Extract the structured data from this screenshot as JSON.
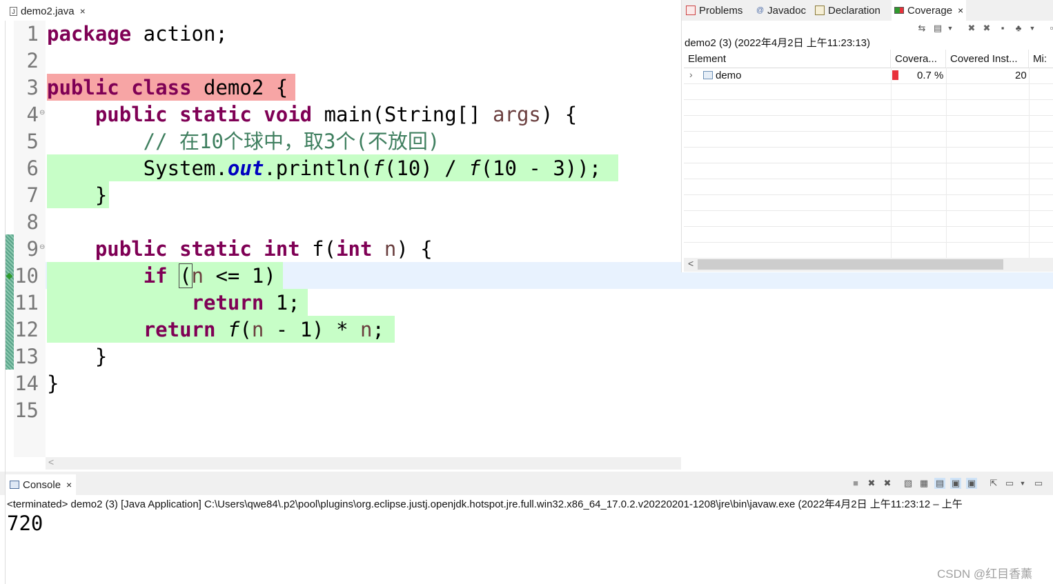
{
  "editor": {
    "tab_label": "demo2.java",
    "tab_close": "×",
    "file_icon": "J",
    "lines": [
      {
        "n": "1"
      },
      {
        "n": "2"
      },
      {
        "n": "3"
      },
      {
        "n": "4"
      },
      {
        "n": "5"
      },
      {
        "n": "6"
      },
      {
        "n": "7"
      },
      {
        "n": "8"
      },
      {
        "n": "9"
      },
      {
        "n": "10"
      },
      {
        "n": "11"
      },
      {
        "n": "12"
      },
      {
        "n": "13"
      },
      {
        "n": "14"
      },
      {
        "n": "15"
      }
    ],
    "code": {
      "l1_kw": "package",
      "l1_rest": " action;",
      "l3_kw1": "public",
      "l3_kw2": " class",
      "l3_rest": " demo2 {",
      "l4_indent": "    ",
      "l4_kw1": "public",
      "l4_kw2": " static",
      "l4_kw3": " void",
      "l4_rest1": " main(String[] ",
      "l4_var": "args",
      "l4_rest2": ") {",
      "l5_comment": "        // 在10个球中，取3个(不放回)",
      "l6_a": "        System.",
      "l6_field": "out",
      "l6_b": ".println(",
      "l6_f1": "f",
      "l6_c": "(10) / ",
      "l6_f2": "f",
      "l6_d": "(10 - 3));",
      "l7": "    }",
      "l9_indent": "    ",
      "l9_kw1": "public",
      "l9_kw2": " static",
      "l9_kw3": " int",
      "l9_rest1": " f(",
      "l9_kw4": "int",
      "l9_space": " ",
      "l9_var": "n",
      "l9_rest2": ") {",
      "l10_indent": "        ",
      "l10_kw": "if",
      "l10_sp": " ",
      "l10_paren": "(",
      "l10_var": "n",
      "l10_rest": " <= 1)",
      "l11_indent": "            ",
      "l11_kw": "return",
      "l11_rest": " 1;",
      "l12_indent": "        ",
      "l12_kw": "return",
      "l12_sp": " ",
      "l12_f": "f",
      "l12_a": "(",
      "l12_var1": "n",
      "l12_b": " - 1) * ",
      "l12_var2": "n",
      "l12_c": ";",
      "l13": "    }",
      "l14": "}"
    },
    "fold_marker": "⊖",
    "scroll_left": "<"
  },
  "right_view": {
    "tabs": [
      {
        "label": "Problems"
      },
      {
        "label": "Javadoc"
      },
      {
        "label": "Declaration"
      },
      {
        "label": "Coverage"
      }
    ],
    "javadoc_icon": "@",
    "close": "×",
    "session_title": "demo2 (3) (2022年4月2日 上午11:23:13)",
    "columns": [
      "Element",
      "Covera...",
      "Covered Inst...",
      "Mi:"
    ],
    "row": {
      "expander": "›",
      "element": "demo",
      "coverage": "0.7 %",
      "covered": "20"
    },
    "coverage_bar_color": "#e8313a",
    "scroll_left": "<"
  },
  "console": {
    "tab_label": "Console",
    "tab_close": "×",
    "status": "<terminated> demo2 (3) [Java Application] C:\\Users\\qwe84\\.p2\\pool\\plugins\\org.eclipse.justj.openjdk.hotspot.jre.full.win32.x86_64_17.0.2.v20220201-1208\\jre\\bin\\javaw.exe  (2022年4月2日 上午11:23:12 – 上午",
    "output": "720"
  },
  "watermark": "CSDN @红目香薰",
  "colors": {
    "keyword": "#7f0055",
    "comment": "#3f7f5f",
    "field": "#0000c0",
    "covered_bg": "#c7fec7",
    "not_covered_bg": "#f7a5a5",
    "current_line": "#e8f2fe"
  }
}
